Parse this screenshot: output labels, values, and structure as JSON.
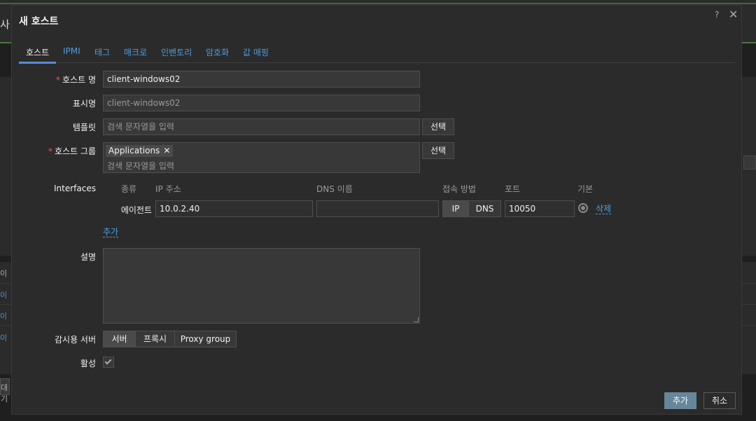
{
  "background": {
    "title_fragment": "사",
    "side_items": [
      "이",
      "이",
      "이",
      "이"
    ],
    "bottom_fragment": "대기"
  },
  "modal": {
    "title": "새 호스트",
    "help": "?",
    "close": "✕"
  },
  "tabs": [
    {
      "label": "호스트",
      "active": true
    },
    {
      "label": "IPMI"
    },
    {
      "label": "태그"
    },
    {
      "label": "매크로"
    },
    {
      "label": "인벤토리"
    },
    {
      "label": "암호화"
    },
    {
      "label": "값 매핑"
    }
  ],
  "form": {
    "host_name": {
      "label": "호스트 명",
      "required_mark": "*",
      "value": "client-windows02"
    },
    "visible_name": {
      "label": "표시명",
      "placeholder": "client-windows02"
    },
    "templates": {
      "label": "템플릿",
      "placeholder": "검색 문자열을 입력",
      "select_label": "선택"
    },
    "host_groups": {
      "label": "호스트 그룹",
      "required_mark": "*",
      "chip": "Applications",
      "chip_remove": "✕",
      "placeholder": "검색 문자열을 입력",
      "select_label": "선택"
    },
    "interfaces": {
      "label": "Interfaces",
      "headers": {
        "type": "종류",
        "ip": "IP 주소",
        "dns": "DNS 이름",
        "connect": "접속 방법",
        "port": "포트",
        "default": "기본"
      },
      "row": {
        "type": "에이전트",
        "ip": "10.0.2.40",
        "dns": "",
        "connect_ip": "IP",
        "connect_dns": "DNS",
        "port": "10050",
        "remove": "삭제"
      },
      "add_link": "추가"
    },
    "description": {
      "label": "설명",
      "value": ""
    },
    "monitored_by": {
      "label": "감시용 서버",
      "options": [
        "서버",
        "프록시",
        "Proxy group"
      ],
      "selected": "서버"
    },
    "enabled": {
      "label": "활성",
      "checked": true
    }
  },
  "footer": {
    "add": "추가",
    "cancel": "취소"
  }
}
